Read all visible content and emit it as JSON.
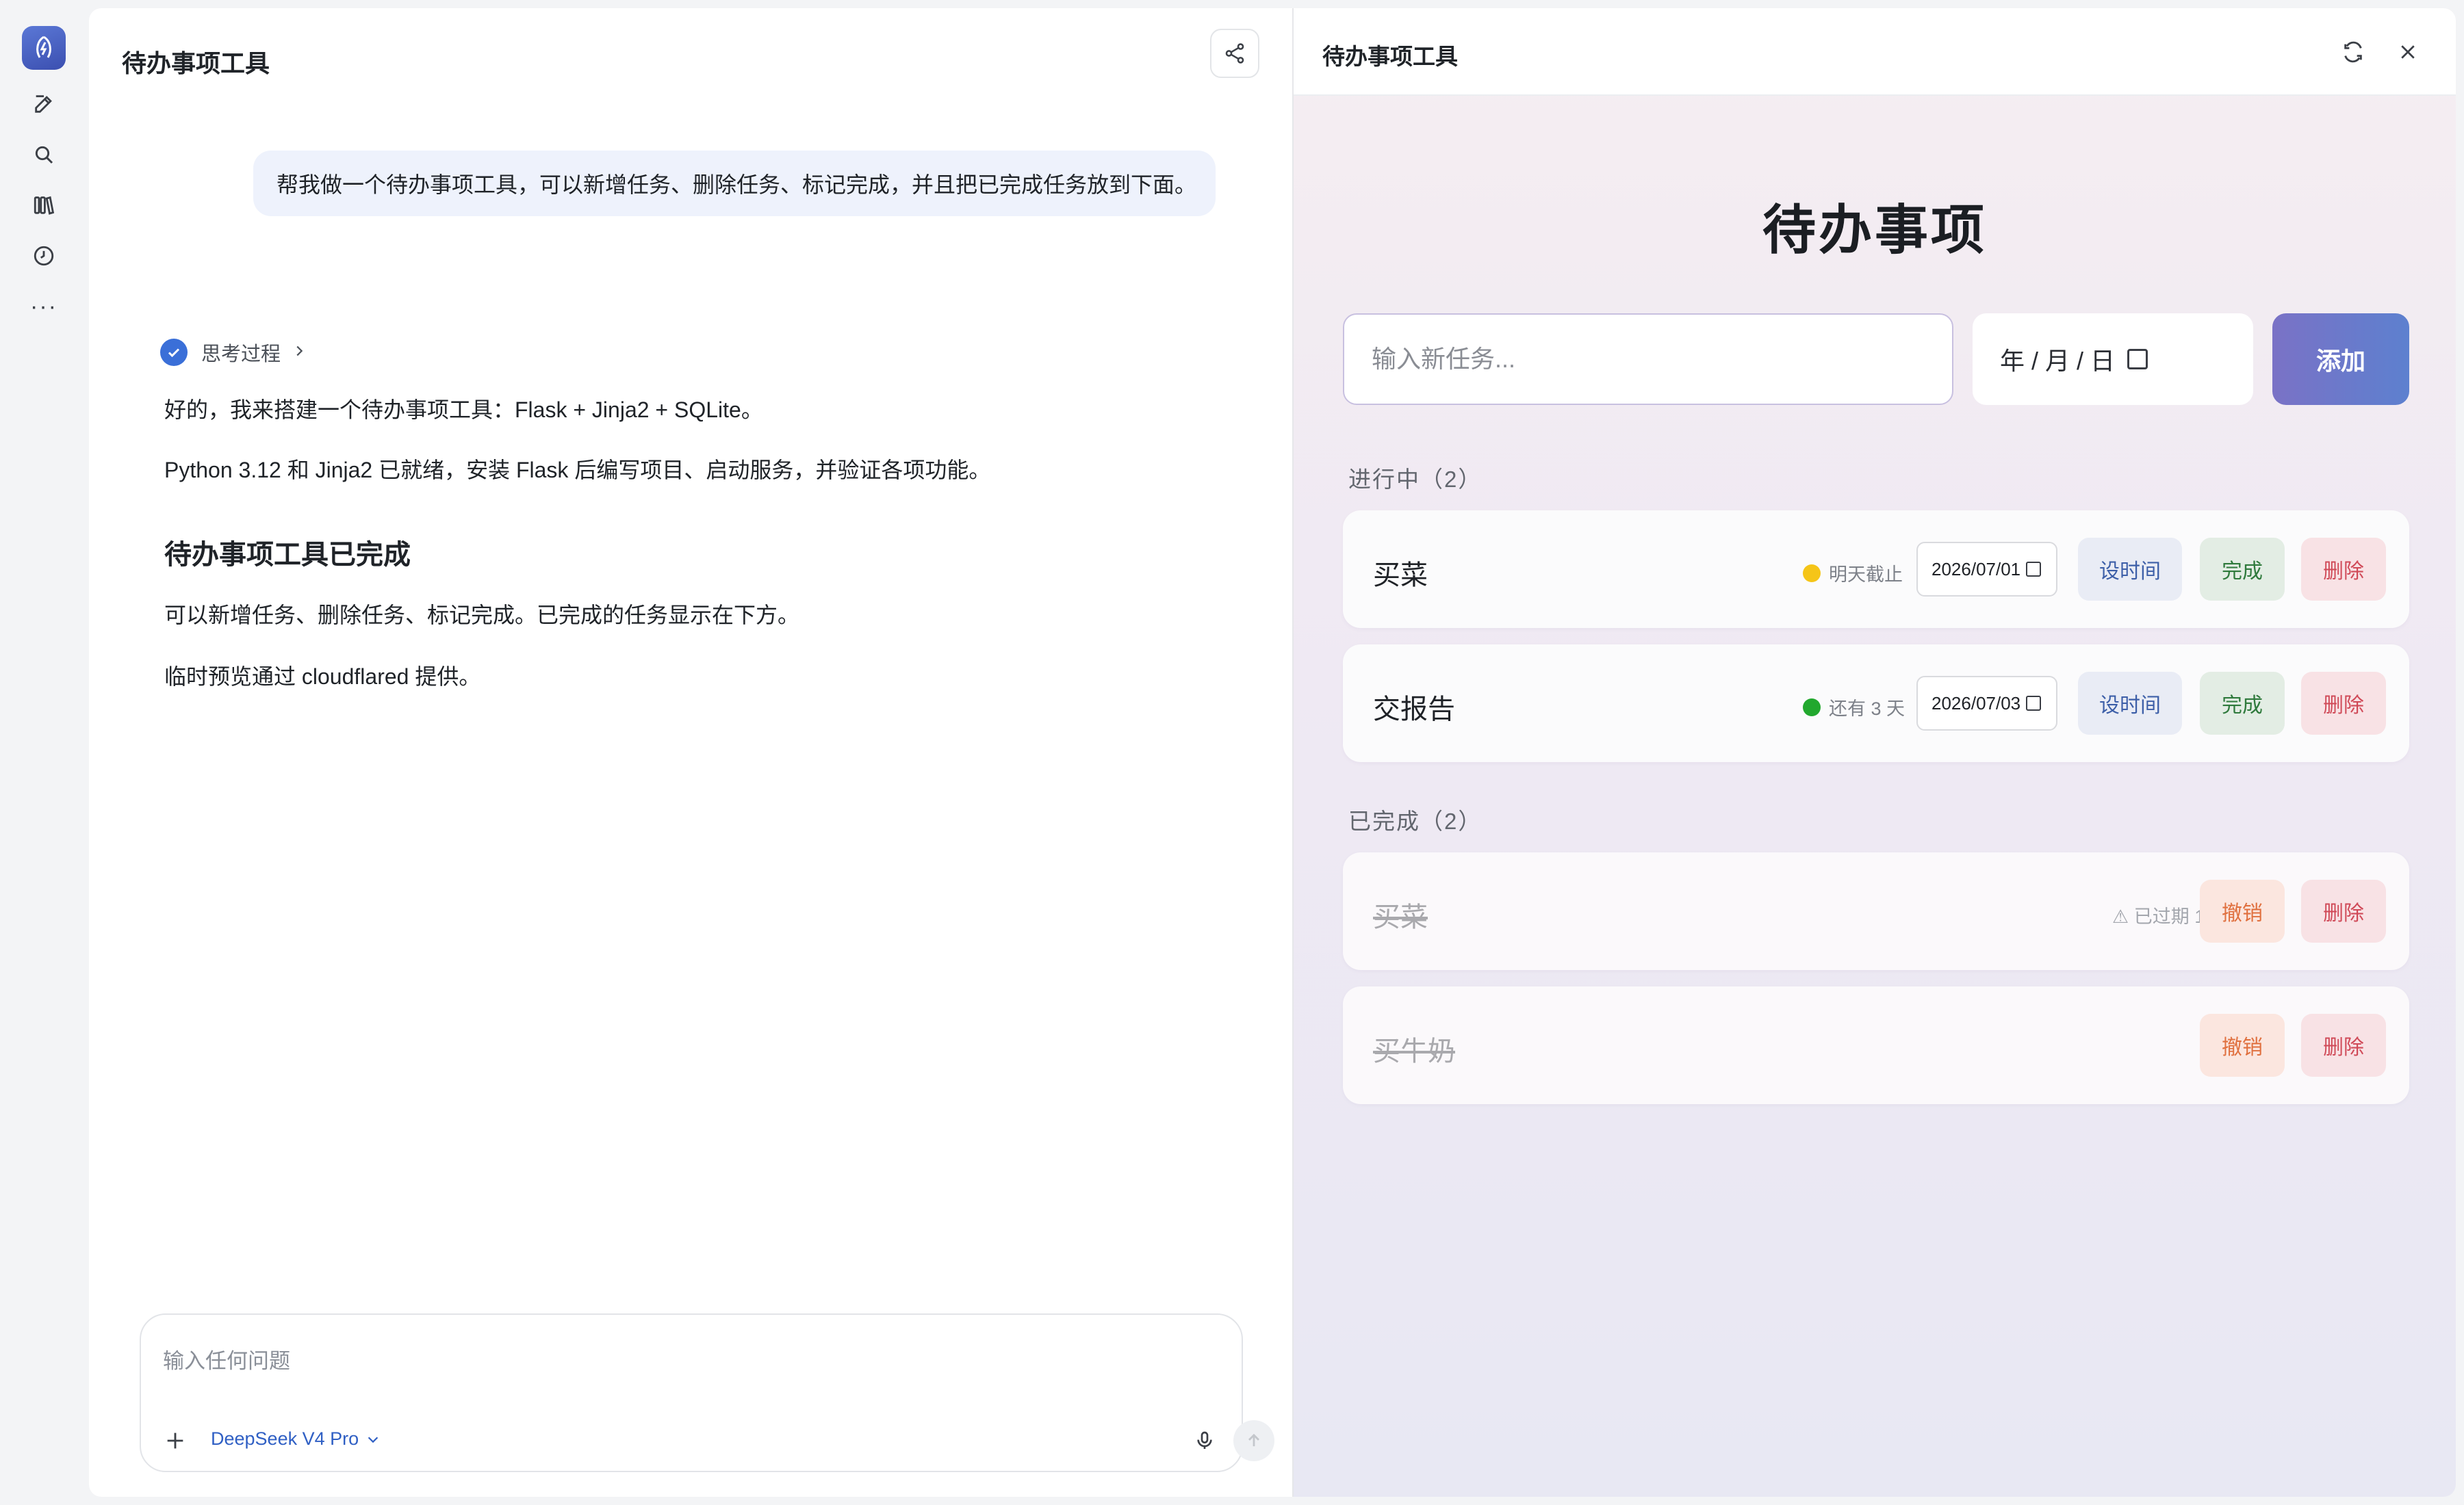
{
  "chat": {
    "title": "待办事项工具",
    "user_message": "帮我做一个待办事项工具，可以新增任务、删除任务、标记完成，并且把已完成任务放到下面。",
    "thinking_label": "思考过程",
    "answer_line1": "好的，我来搭建一个待办事项工具：Flask + Jinja2 + SQLite。",
    "answer_line2": "Python 3.12 和 Jinja2 已就绪，安装 Flask 后编写项目、启动服务，并验证各项功能。",
    "answer_heading": "待办事项工具已完成",
    "answer_line3": "可以新增任务、删除任务、标记完成。已完成的任务显示在下方。",
    "answer_line4": "临时预览通过 cloudflared 提供。",
    "composer_placeholder": "输入任何问题",
    "model_name": "DeepSeek V4 Pro"
  },
  "preview": {
    "title": "待办事项工具",
    "app_title": "待办事项",
    "task_placeholder": "输入新任务...",
    "date_placeholder": "年 / 月 / 日",
    "add_label": "添加",
    "in_progress_title": "进行中（2）",
    "done_title": "已完成（2）",
    "active_tasks": [
      {
        "name": "买菜",
        "status": "明天截止",
        "status_color": "#f5c518",
        "date": "2026/07/01",
        "settime": "设时间",
        "finish": "完成",
        "delete": "删除"
      },
      {
        "name": "交报告",
        "status": "还有 3 天",
        "status_color": "#22a82e",
        "date": "2026/07/03",
        "settime": "设时间",
        "finish": "完成",
        "delete": "删除"
      }
    ],
    "done_tasks": [
      {
        "name": "买菜",
        "status": "⚠ 已过期 1 天",
        "undo": "撤销",
        "delete": "删除"
      },
      {
        "name": "买牛奶",
        "undo": "撤销",
        "delete": "删除"
      }
    ]
  },
  "colors": {
    "accent": "#3a6fd8",
    "add_gradient_start": "#7a72c6",
    "add_gradient_end": "#5d80cf"
  },
  "icons": [
    "app-logo-icon",
    "new-chat-icon",
    "search-icon",
    "library-icon",
    "history-icon",
    "more-icon",
    "share-icon",
    "check-icon",
    "chevron-right-icon",
    "plus-icon",
    "chevron-down-icon",
    "mic-icon",
    "send-arrow-icon",
    "refresh-icon",
    "close-icon",
    "calendar-icon"
  ]
}
